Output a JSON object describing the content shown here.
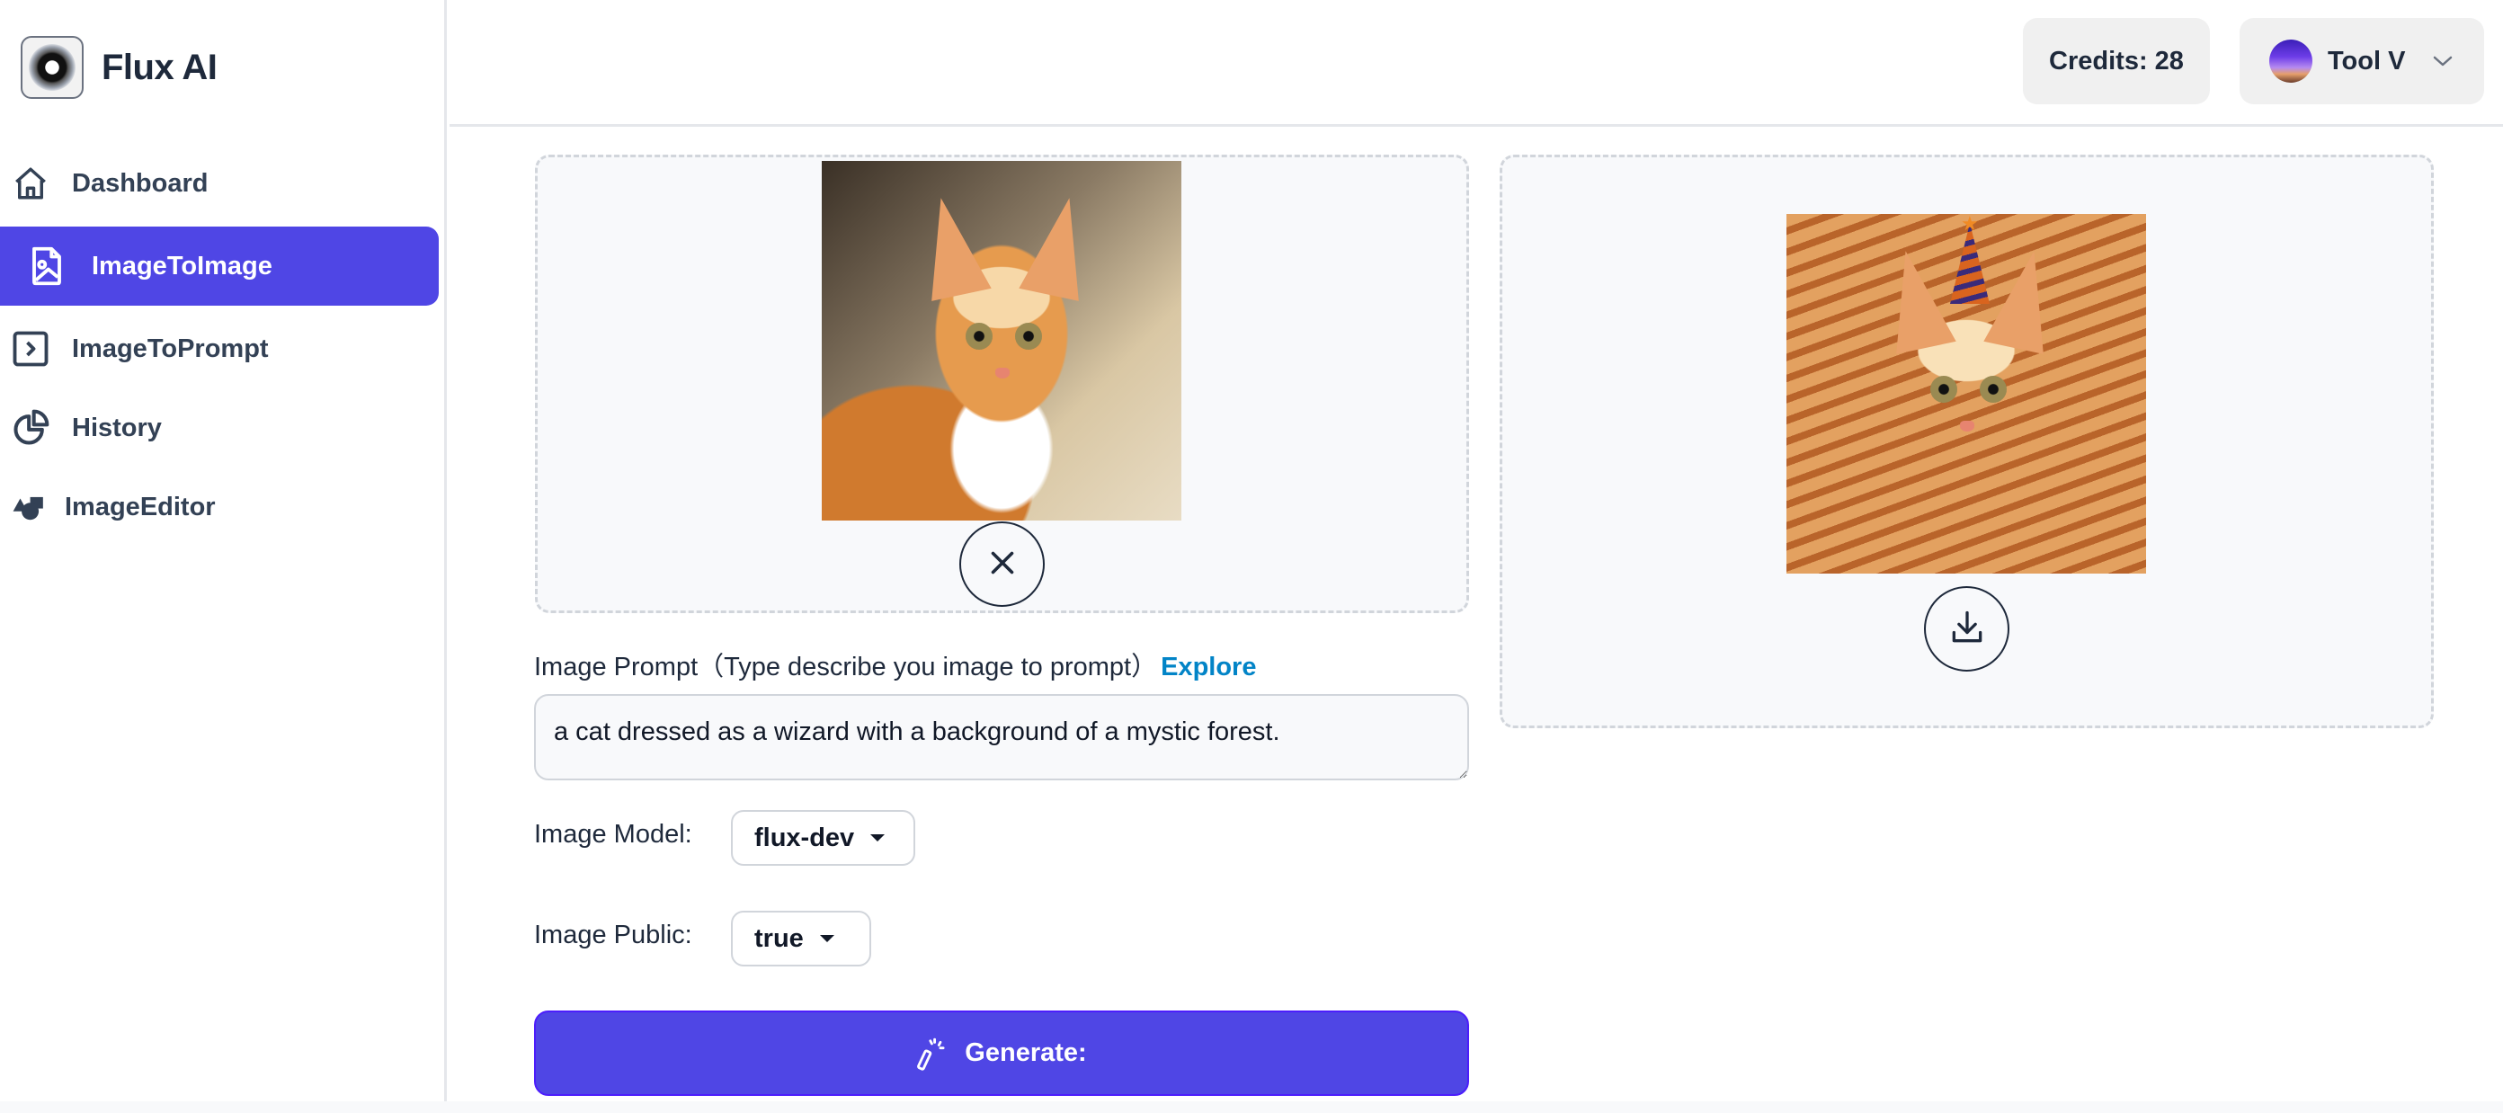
{
  "app": {
    "name": "Flux AI",
    "logo_icon": "vinyl-disc-logo"
  },
  "sidebar": {
    "items": [
      {
        "label": "Dashboard",
        "icon": "home-icon",
        "active": false
      },
      {
        "label": "ImageToImage",
        "icon": "file-image-icon",
        "active": true
      },
      {
        "label": "ImageToPrompt",
        "icon": "chevron-square-icon",
        "active": false
      },
      {
        "label": "History",
        "icon": "pie-chart-icon",
        "active": false
      },
      {
        "label": "ImageEditor",
        "icon": "shapes-icon",
        "active": false
      }
    ]
  },
  "header": {
    "credits_label": "Credits: 28",
    "credits": 28,
    "user_name": "Tool V",
    "user_menu_icon": "chevron-down-icon"
  },
  "upload": {
    "image_alt": "orange tabby cat sitting in sunlight",
    "remove_icon": "close-icon"
  },
  "result": {
    "image_alt": "orange tabby cat wearing a striped party hat",
    "download_icon": "download-icon"
  },
  "form": {
    "prompt_label": "Image Prompt（Type describe you image to prompt）",
    "explore_link": "Explore",
    "prompt_value": "a cat dressed as a wizard with a background of a mystic forest.",
    "model_label": "Image Model:",
    "model_value": "flux-dev",
    "public_label": "Image Public:",
    "public_value": "true",
    "generate_label": "Generate:",
    "generate_icon": "magic-wand-icon"
  },
  "colors": {
    "accent": "#4f46e5",
    "link": "#0284c7",
    "text": "#1e293b",
    "panel_bg": "#f8f9fb",
    "border": "#d1d5db"
  }
}
